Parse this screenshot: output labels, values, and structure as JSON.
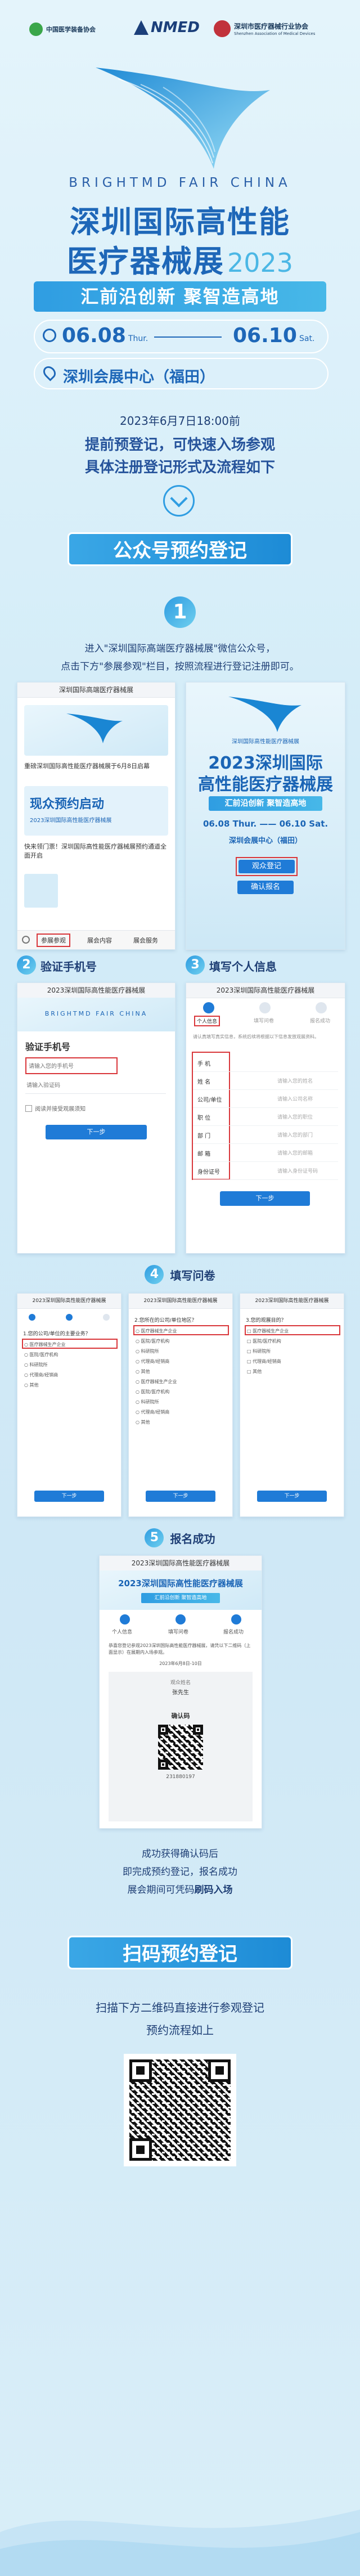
{
  "logos": {
    "left": "中国医学装备协会",
    "mid": "NMED",
    "right_cn": "深圳市医疗器械行业协会",
    "right_en": "Shenzhen Association of Medical Devices"
  },
  "hero": {
    "en_title": "BRIGHTMD FAIR CHINA",
    "title_line1": "深圳国际高性能",
    "title_line2": "医疗器械展",
    "year": "2023",
    "slogan": "汇前沿创新  聚智造高地",
    "date_start": "06.08",
    "date_start_day": "Thur.",
    "date_end": "06.10",
    "date_end_day": "Sat.",
    "venue": "深圳会展中心（福田）"
  },
  "intro": {
    "time": "2023年6月7日18:00前",
    "line1": "提前预登记，可快速入场参观",
    "line2": "具体注册登记形式及流程如下"
  },
  "section1": {
    "title": "公众号预约登记"
  },
  "step1": {
    "num": "1",
    "text1": "进入\"深圳国际高端医疗器械展\"微信公众号，",
    "text2": "点击下方\"参展参观\"栏目，按照流程进行登记注册即可。",
    "left_shot": {
      "header": "深圳国际高端医疗器械展",
      "article1": "重磅深圳国际高性能医疗器械展于6月8日启幕",
      "card_title": "现众预约启动",
      "card_sub": "2023深圳国际高性能医疗器械展",
      "article2": "快来领门票！深圳国际高性能医疗器械展预约通道全面开启",
      "menu": [
        "参展参观",
        "展会内容",
        "展会服务"
      ]
    },
    "right_shot": {
      "brand": "深圳国际高性能医疗器械展",
      "title1": "2023深圳国际",
      "title2": "高性能医疗器械展",
      "slogan": "汇前沿创新  聚智造高地",
      "dates": "06.08 Thur. —— 06.10 Sat.",
      "venue": "深圳会展中心（福田）",
      "btn1": "观众登记",
      "btn2": "确认报名"
    }
  },
  "step2": {
    "num": "2",
    "label": "验证手机号",
    "shot": {
      "header": "2023深圳国际高性能医疗器械展",
      "banner_en": "BRIGHTMD FAIR CHINA",
      "heading": "验证手机号",
      "phone_placeholder": "请输入您的手机号",
      "code_placeholder": "请输入验证码",
      "checkbox": "阅读并接受观展须知",
      "next": "下一步"
    }
  },
  "step3": {
    "num": "3",
    "label": "填写个人信息",
    "shot": {
      "header": "2023深圳国际高性能医疗器械展",
      "tabs": [
        "个人信息",
        "填写问卷",
        "报名成功"
      ],
      "notice": "请认真填写真实信息，系统后续将根据以下信息发放观展资料。",
      "fields": [
        {
          "label": "手  机",
          "value": ""
        },
        {
          "label": "姓  名",
          "value": "请输入您的姓名"
        },
        {
          "label": "公司/单位",
          "value": "请输入公司名称"
        },
        {
          "label": "职  位",
          "value": "请输入您的职位"
        },
        {
          "label": "部  门",
          "value": "请输入您的部门"
        },
        {
          "label": "邮  箱",
          "value": "请输入您的邮箱"
        },
        {
          "label": "身份证号",
          "value": "请输入身份证号码"
        }
      ],
      "next": "下一步"
    }
  },
  "step4": {
    "num": "4",
    "label": "填写问卷",
    "shot_header": "2023深圳国际高性能医疗器械展",
    "q1": "1.您的公司/单位的主要业务？",
    "q2": "2.您所在的公司/单位地区？",
    "q3": "3.您的观展目的？",
    "options": [
      "医疗器械生产企业",
      "医院/医疗机构",
      "科研院所",
      "代理商/经销商",
      "其他"
    ],
    "next": "下一步"
  },
  "step5": {
    "num": "5",
    "label": "报名成功",
    "shot": {
      "header": "2023深圳国际高性能医疗器械展",
      "title": "2023深圳国际高性能医疗器械展",
      "slogan": "汇前沿创新  聚智造高地",
      "tabs": [
        "个人信息",
        "填写问卷",
        "报名成功"
      ],
      "msg": "恭喜您登记参观2023深圳国际高性能医疗器械展，请凭以下二维码（上面显示）在展期内入场参观。",
      "date_range": "2023年6月8日-10日",
      "name_label": "观众姓名",
      "name": "张先生",
      "code_label": "确认码",
      "code_no": "231880197"
    },
    "after1": "成功获得确认码后",
    "after2": "即完成预约登记，报名成功",
    "after3_a": "展会期间可凭码",
    "after3_b": "刷码入场"
  },
  "section2": {
    "title": "扫码预约登记",
    "line1": "扫描下方二维码直接进行参观登记",
    "line2": "预约流程如上"
  },
  "colors": {
    "primary": "#1d8bd6",
    "navy": "#1f3f75",
    "bg": "#d7edf8",
    "red": "#d9373b"
  }
}
